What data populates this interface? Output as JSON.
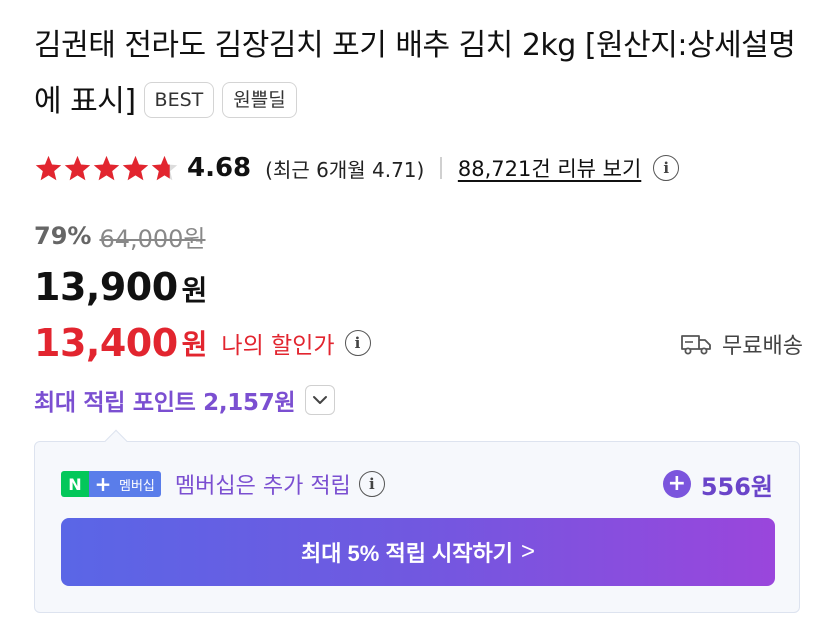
{
  "product": {
    "title": "김권태 전라도 김장김치 포기 배추 김치 2kg [원산지:상세설명에 표시]",
    "badges": [
      "BEST",
      "원쁠딜"
    ]
  },
  "rating": {
    "stars_value": 4.68,
    "value_text": "4.68",
    "recent_text": "(최근 6개월 4.71)",
    "review_link": "88,721건 리뷰 보기",
    "info_glyph": "i",
    "star_color": "#e2252f"
  },
  "pricing": {
    "discount_rate": "79%",
    "original_price": "64,000원",
    "price": "13,900",
    "price_unit": "원",
    "my_price": "13,400",
    "my_price_unit": "원",
    "my_price_label": "나의 할인가",
    "accent_color": "#e2252f"
  },
  "shipping": {
    "label": "무료배송",
    "icon": "truck-icon"
  },
  "points": {
    "text": "최대 적립 포인트 2,157원",
    "expand_icon": "chevron-down-icon",
    "color": "#7b4fd1"
  },
  "membership": {
    "logo_n": "N",
    "logo_plus": "+",
    "logo_text": "멤버십",
    "label": "멤버십은 추가 적립",
    "extra_points": "556원",
    "plus_glyph": "+",
    "cta_label": "최대 5% 적립 시작하기",
    "cta_arrow": ">"
  }
}
